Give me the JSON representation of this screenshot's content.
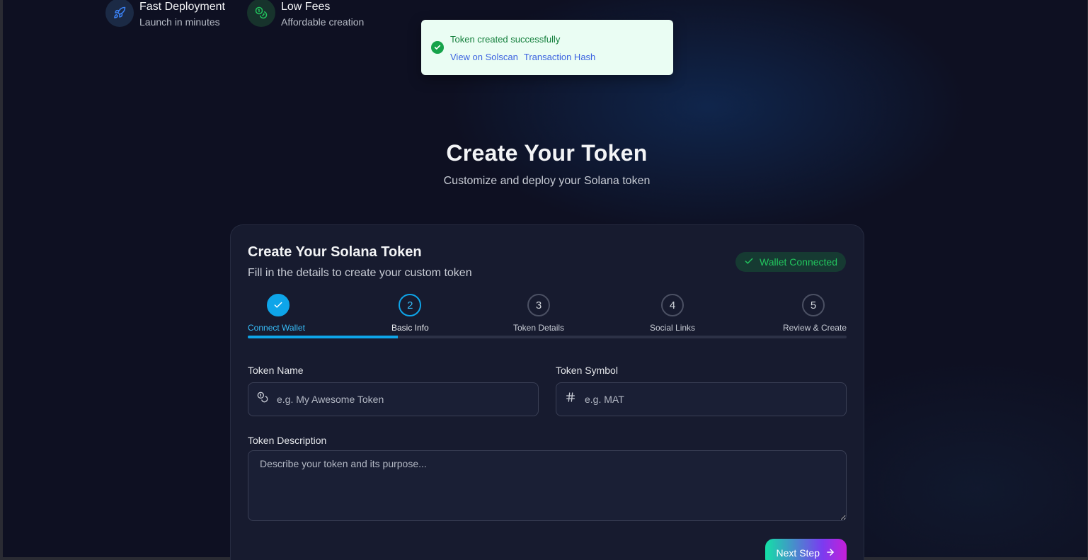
{
  "features": [
    {
      "title": "Fast Deployment",
      "subtitle": "Launch in minutes",
      "icon": "rocket-icon"
    },
    {
      "title": "Low Fees",
      "subtitle": "Affordable creation",
      "icon": "coins-icon"
    }
  ],
  "toast": {
    "message": "Token created successfully",
    "link_solscan": "View on Solscan",
    "link_hash": "Transaction Hash",
    "icon": "check-circle-icon"
  },
  "hero": {
    "title": "Create Your Token",
    "subtitle": "Customize and deploy your Solana token"
  },
  "card": {
    "title": "Create Your Solana Token",
    "subtitle": "Fill in the details to create your custom token",
    "wallet_status": "Wallet Connected"
  },
  "steps": [
    {
      "number": "",
      "label": "Connect Wallet",
      "state": "done"
    },
    {
      "number": "2",
      "label": "Basic Info",
      "state": "active"
    },
    {
      "number": "3",
      "label": "Token Details",
      "state": "pending"
    },
    {
      "number": "4",
      "label": "Social Links",
      "state": "pending"
    },
    {
      "number": "5",
      "label": "Review & Create",
      "state": "pending"
    }
  ],
  "progress": {
    "fraction": 0.25
  },
  "form": {
    "name_label": "Token Name",
    "name_placeholder": "e.g. My Awesome Token",
    "symbol_label": "Token Symbol",
    "symbol_placeholder": "e.g. MAT",
    "description_label": "Token Description",
    "description_placeholder": "Describe your token and its purpose..."
  },
  "next_button": {
    "label": "Next Step",
    "icon": "arrow-right-icon"
  },
  "colors": {
    "accent": "#0ea5e9",
    "success": "#22c55e",
    "background": "#0e1022",
    "card": "#171b2f"
  }
}
